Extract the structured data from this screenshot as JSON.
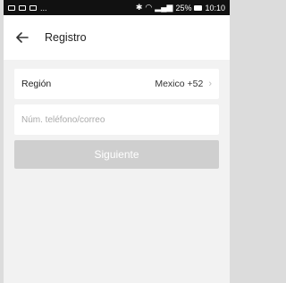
{
  "status_bar": {
    "left_dots": "...",
    "right_text": "25%",
    "time": "10:10"
  },
  "header": {
    "title": "Registro",
    "back_icon": "arrow-left-icon"
  },
  "form": {
    "region_label": "Región",
    "region_value": "Mexico +52",
    "region_chevron": "›",
    "phone_placeholder": "Núm. teléfono/correo",
    "next_label": "Siguiente"
  },
  "colors": {
    "background": "#f2f2f2",
    "button_disabled": "#cfcfcf"
  }
}
